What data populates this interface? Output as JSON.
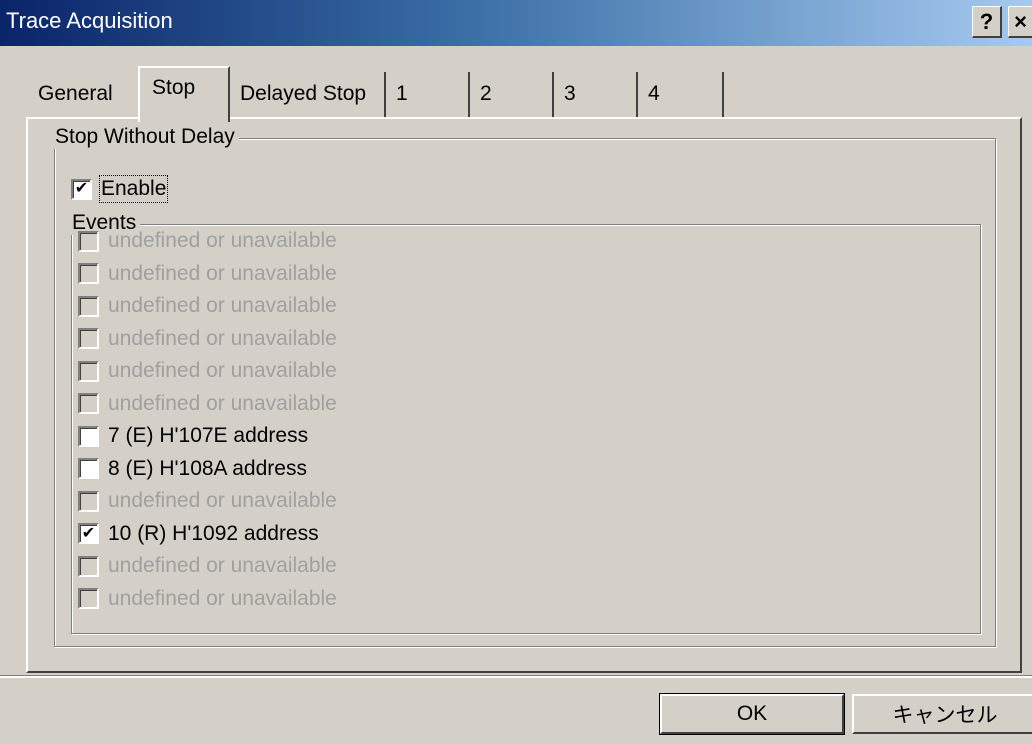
{
  "window": {
    "title": "Trace Acquisition",
    "help_label": "?",
    "close_label": "×"
  },
  "tabs": [
    {
      "label": "General"
    },
    {
      "label": "Stop"
    },
    {
      "label": "Delayed Stop"
    },
    {
      "label": "1"
    },
    {
      "label": "2"
    },
    {
      "label": "3"
    },
    {
      "label": "4"
    }
  ],
  "active_tab": "Stop",
  "stop_group": {
    "legend": "Stop Without Delay",
    "enable": {
      "label": "Enable",
      "checked": true
    }
  },
  "events_group": {
    "legend": "Events",
    "items": [
      {
        "label": "undefined or unavailable",
        "checked": false,
        "enabled": false
      },
      {
        "label": "undefined or unavailable",
        "checked": false,
        "enabled": false
      },
      {
        "label": "undefined or unavailable",
        "checked": false,
        "enabled": false
      },
      {
        "label": "undefined or unavailable",
        "checked": false,
        "enabled": false
      },
      {
        "label": "undefined or unavailable",
        "checked": false,
        "enabled": false
      },
      {
        "label": "undefined or unavailable",
        "checked": false,
        "enabled": false
      },
      {
        "label": "7 (E) H'107E address",
        "checked": false,
        "enabled": true
      },
      {
        "label": "8 (E) H'108A address",
        "checked": false,
        "enabled": true
      },
      {
        "label": "undefined or unavailable",
        "checked": false,
        "enabled": false
      },
      {
        "label": "10 (R) H'1092 address",
        "checked": true,
        "enabled": true
      },
      {
        "label": "undefined or unavailable",
        "checked": false,
        "enabled": false
      },
      {
        "label": "undefined or unavailable",
        "checked": false,
        "enabled": false
      }
    ]
  },
  "buttons": {
    "ok": "OK",
    "cancel": "キャンセル"
  }
}
